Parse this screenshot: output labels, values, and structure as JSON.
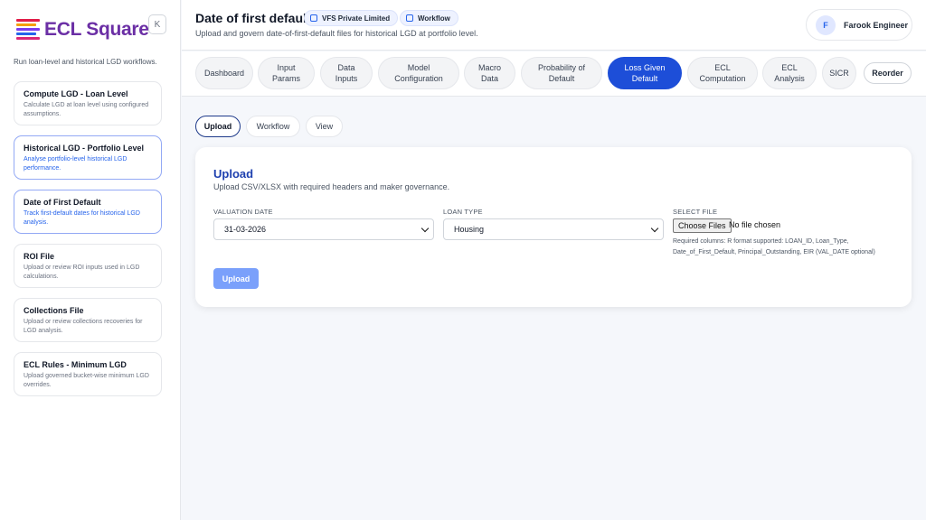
{
  "brand": {
    "name": "ECL Square"
  },
  "sidebar": {
    "collapse_label": "K",
    "caption": "Run loan-level and historical LGD workflows.",
    "items": [
      {
        "title": "Compute LGD - Loan Level",
        "subtitle": "Calculate LGD at loan level using configured assumptions."
      },
      {
        "title": "Historical LGD - Portfolio Level",
        "subtitle": "Analyse portfolio-level historical LGD performance."
      },
      {
        "title": "Date of First Default",
        "subtitle": "Track first-default dates for historical LGD analysis."
      },
      {
        "title": "ROI File",
        "subtitle": "Upload or review ROI inputs used in LGD calculations."
      },
      {
        "title": "Collections File",
        "subtitle": "Upload or review collections recoveries for LGD analysis."
      },
      {
        "title": "ECL Rules - Minimum LGD",
        "subtitle": "Upload governed bucket-wise minimum LGD overrides."
      }
    ]
  },
  "header": {
    "title": "Date of first default",
    "chips": [
      "VFS Private Limited",
      "Workflow"
    ],
    "subtitle": "Upload and govern date-of-first-default files for historical LGD at portfolio level.",
    "user": {
      "initial": "F",
      "name": "Farook Engineer"
    }
  },
  "tabs": {
    "items": [
      {
        "l1": "Dashboard",
        "l2": ""
      },
      {
        "l1": "Input",
        "l2": "Params"
      },
      {
        "l1": "Data",
        "l2": "Inputs"
      },
      {
        "l1": "Model",
        "l2": "Configuration"
      },
      {
        "l1": "Macro",
        "l2": "Data"
      },
      {
        "l1": "Probability of",
        "l2": "Default"
      },
      {
        "l1": "Loss Given",
        "l2": "Default"
      },
      {
        "l1": "ECL",
        "l2": "Computation"
      },
      {
        "l1": "ECL",
        "l2": "Analysis"
      },
      {
        "l1": "SICR",
        "l2": ""
      }
    ],
    "reorder_label": "Reorder"
  },
  "subtabs": [
    "Upload",
    "Workflow",
    "View"
  ],
  "upload_card": {
    "title": "Upload",
    "subtitle": "Upload CSV/XLSX with required headers and maker governance.",
    "valuation_label": "VALUATION DATE",
    "valuation_value": "31-03-2026",
    "loan_type_label": "LOAN TYPE",
    "loan_type_value": "Housing",
    "select_file_label": "SELECT FILE",
    "choose_files_label": "Choose Files",
    "file_status": "No file chosen",
    "hint": "Required columns: R format supported: LOAN_ID, Loan_Type, Date_of_First_Default, Principal_Outstanding, EIR (VAL_DATE optional)",
    "upload_label": "Upload"
  },
  "colors": {
    "primary": "#1d4ed8",
    "upload_btn": "#7aa0fb",
    "brand_text": "#6b2fa5"
  }
}
